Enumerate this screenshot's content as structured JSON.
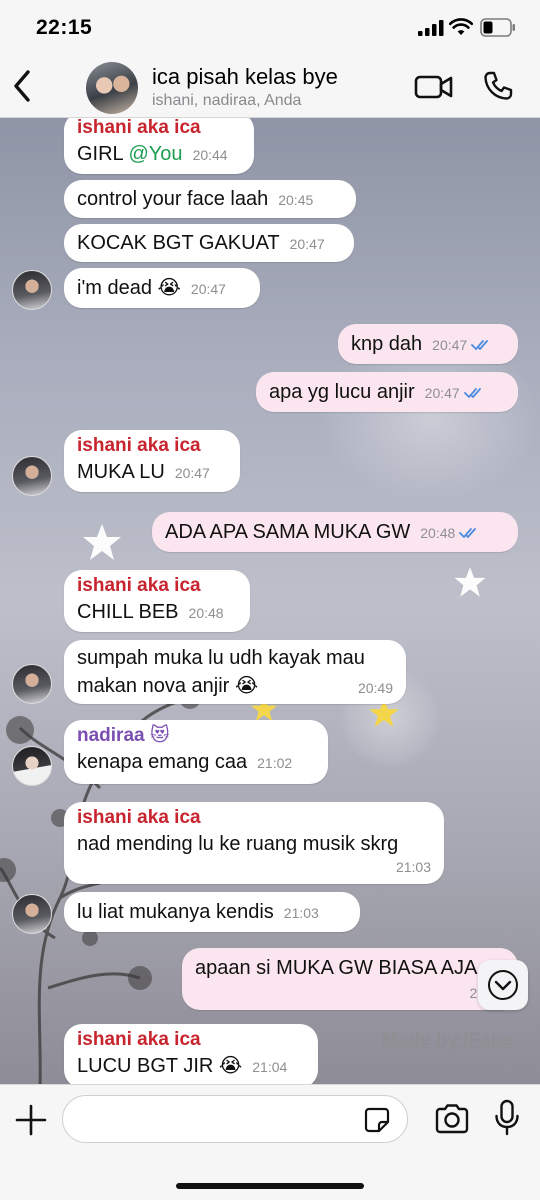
{
  "status_bar": {
    "time": "22:15"
  },
  "header": {
    "title": "ica pisah kelas bye",
    "subtitle": "ishani, nadiraa, Anda"
  },
  "messages": [
    {
      "side": "in",
      "sender": "ishani aka ica",
      "text": "GIRL ",
      "mention": "@You",
      "time": "20:44"
    },
    {
      "side": "in",
      "text": "control your face laah",
      "time": "20:45"
    },
    {
      "side": "in",
      "text": "KOCAK BGT GAKUAT",
      "time": "20:47"
    },
    {
      "side": "in",
      "text": "i'm dead 😭",
      "time": "20:47"
    },
    {
      "side": "out",
      "text": "knp dah",
      "time": "20:47"
    },
    {
      "side": "out",
      "text": "apa yg lucu anjir",
      "time": "20:47"
    },
    {
      "side": "in",
      "sender": "ishani aka ica",
      "text": "MUKA LU",
      "time": "20:47"
    },
    {
      "side": "out",
      "text": "ADA APA SAMA MUKA GW",
      "time": "20:48"
    },
    {
      "side": "in",
      "sender": "ishani aka ica",
      "text": "CHILL BEB",
      "time": "20:48"
    },
    {
      "side": "in",
      "text_line1": "sumpah muka lu udh kayak mau",
      "text_line2": "makan nova anjir 😭",
      "time": "20:49"
    },
    {
      "side": "in",
      "sender": "nadiraa 😻",
      "text": "kenapa emang caa",
      "time": "21:02"
    },
    {
      "side": "in",
      "sender": "ishani aka ica",
      "text": "nad mending lu ke ruang musik skrg",
      "time": "21:03"
    },
    {
      "side": "in",
      "text": "lu liat mukanya kendis",
      "time": "21:03"
    },
    {
      "side": "out",
      "text": "apaan si MUKA GW BIASA AJA",
      "time": "21:"
    },
    {
      "side": "in",
      "sender": "ishani aka ica",
      "text": "LUCU BGT JIR 😭",
      "time": "21:04"
    }
  ],
  "watermark": "Made by iFake",
  "composer": {
    "placeholder": ""
  },
  "colors": {
    "sender_ishani": "#c8242e",
    "sender_nadiraa": "#7a4fb1",
    "mention": "#1e9e52",
    "outgoing_bubble": "#fbe6ef",
    "read_ticks": "#4a8be0"
  },
  "icons": [
    "back-chevron-icon",
    "video-call-icon",
    "phone-icon",
    "plus-icon",
    "sticker-icon",
    "camera-icon",
    "microphone-icon",
    "scroll-down-icon"
  ]
}
